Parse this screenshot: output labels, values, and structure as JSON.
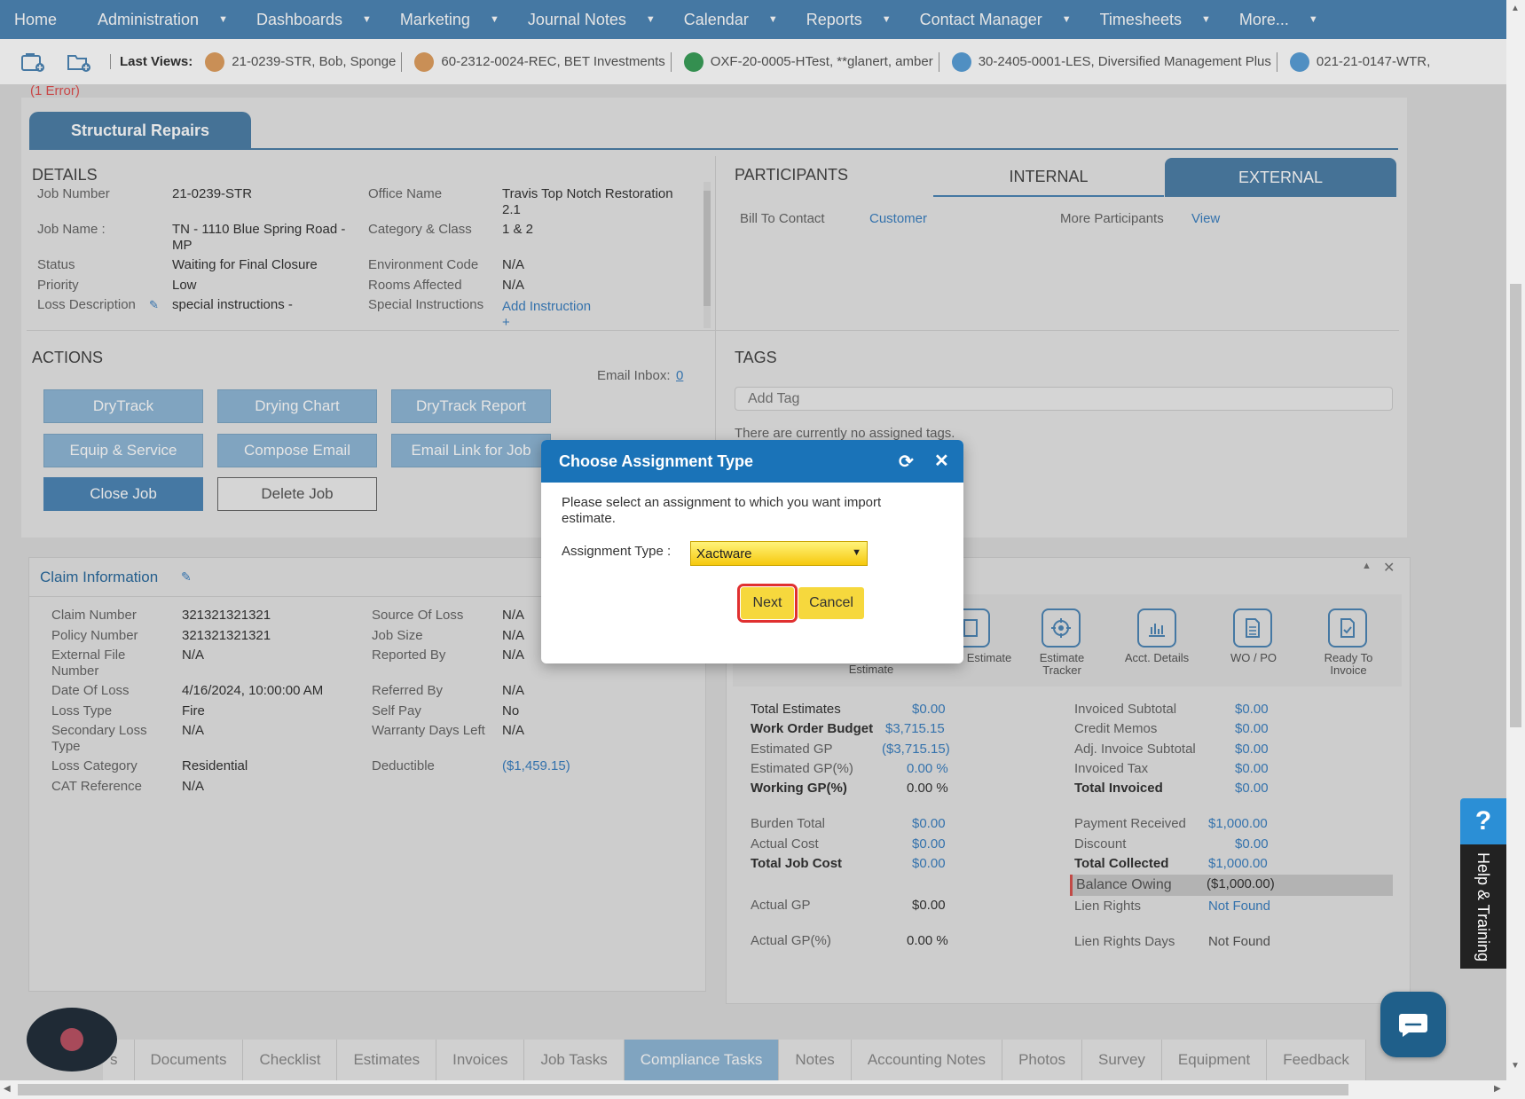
{
  "nav": {
    "home": "Home",
    "items": [
      "Administration",
      "Dashboards",
      "Marketing",
      "Journal Notes",
      "Calendar",
      "Reports",
      "Contact Manager",
      "Timesheets",
      "More..."
    ]
  },
  "last_views": {
    "label": "Last Views:",
    "items": [
      {
        "text": "21-0239-STR, Bob, Sponge",
        "color": "#e0a060"
      },
      {
        "text": "60-2312-0024-REC, BET Investments",
        "color": "#e0a060"
      },
      {
        "text": "OXF-20-0005-HTest, **glanert, amber",
        "color": "#3aa05a"
      },
      {
        "text": "30-2405-0001-LES, Diversified Management Plus",
        "color": "#5aa0d8"
      },
      {
        "text": "021-21-0147-WTR,",
        "color": "#5aa0d8"
      }
    ]
  },
  "error_text": "(1 Error)",
  "job_tab": "Structural Repairs",
  "details": {
    "title": "DETAILS",
    "left": [
      {
        "label": "Job Number",
        "value": "21-0239-STR"
      },
      {
        "label": "Job Name :",
        "value": "TN - 1110 Blue Spring Road - MP"
      },
      {
        "label": "Status",
        "value": "Waiting for Final Closure"
      },
      {
        "label": "Priority",
        "value": "Low"
      },
      {
        "label": "Loss Description",
        "value": "special instructions -"
      }
    ],
    "right": [
      {
        "label": "Office Name",
        "value": "Travis Top Notch Restoration 2.1"
      },
      {
        "label": "Category & Class",
        "value": "1 & 2"
      },
      {
        "label": "Environment Code",
        "value": "N/A"
      },
      {
        "label": "Rooms Affected",
        "value": "N/A"
      },
      {
        "label": "Special Instructions",
        "value": "Add Instruction +"
      }
    ]
  },
  "participants": {
    "title": "PARTICIPANTS",
    "tab_internal": "INTERNAL",
    "tab_external": "EXTERNAL",
    "bill_to_label": "Bill To Contact",
    "bill_to_value": "Customer",
    "more_label": "More Participants",
    "more_value": "View"
  },
  "actions": {
    "title": "ACTIONS",
    "email_inbox_label": "Email Inbox:",
    "email_inbox_count": "0",
    "buttons": {
      "drytrack": "DryTrack",
      "drying_chart": "Drying Chart",
      "drytrack_report": "DryTrack Report",
      "equip_service": "Equip & Service",
      "compose_email": "Compose Email",
      "email_link": "Email Link for Job",
      "close_job": "Close Job",
      "delete_job": "Delete Job"
    }
  },
  "tags": {
    "title": "TAGS",
    "placeholder": "Add Tag",
    "empty": "There are currently no assigned tags."
  },
  "claim": {
    "title": "Claim Information",
    "left": [
      {
        "label": "Claim Number",
        "value": "321321321321"
      },
      {
        "label": "Policy Number",
        "value": "321321321321"
      },
      {
        "label": "External File Number",
        "value": "N/A"
      },
      {
        "label": "Date Of Loss",
        "value": "4/16/2024, 10:00:00 AM"
      },
      {
        "label": "Loss Type",
        "value": "Fire"
      },
      {
        "label": "Secondary Loss Type",
        "value": "N/A"
      },
      {
        "label": "Loss Category",
        "value": "Residential"
      },
      {
        "label": "CAT Reference",
        "value": "N/A"
      }
    ],
    "right": [
      {
        "label": "Source Of Loss",
        "value": "N/A"
      },
      {
        "label": "Job Size",
        "value": "N/A"
      },
      {
        "label": "Reported By",
        "value": "N/A"
      },
      {
        "label": "Referred By",
        "value": "N/A"
      },
      {
        "label": "Self Pay",
        "value": "No"
      },
      {
        "label": "Warranty Days Left",
        "value": "N/A"
      },
      {
        "label": "Deductible",
        "value": "($1,459.15)"
      }
    ]
  },
  "financial": {
    "icons": [
      {
        "label": "Estimate"
      },
      {
        "label": "Estimate Tracker"
      },
      {
        "label": "Acct. Details"
      },
      {
        "label": "WO / PO"
      },
      {
        "label": "Ready To Invoice"
      }
    ],
    "partial_label": "Estimate",
    "left": [
      {
        "label": "Total Estimates",
        "value": "$0.00"
      },
      {
        "label": "Work Order Budget",
        "value": "$3,715.15"
      },
      {
        "label": "Estimated GP",
        "value": "($3,715.15)"
      },
      {
        "label": "Estimated GP(%)",
        "value": "0.00 %"
      },
      {
        "label": "Working GP(%)",
        "value": "0.00 %"
      },
      {
        "label": "Burden Total",
        "value": "$0.00"
      },
      {
        "label": "Actual Cost",
        "value": "$0.00"
      },
      {
        "label": "Total Job Cost",
        "value": "$0.00"
      },
      {
        "label": "Actual GP",
        "value": "$0.00"
      },
      {
        "label": "Actual GP(%)",
        "value": "0.00 %"
      }
    ],
    "right": [
      {
        "label": "Invoiced Subtotal",
        "value": "$0.00"
      },
      {
        "label": "Credit Memos",
        "value": "$0.00"
      },
      {
        "label": "Adj. Invoice Subtotal",
        "value": "$0.00"
      },
      {
        "label": "Invoiced Tax",
        "value": "$0.00"
      },
      {
        "label": "Total Invoiced",
        "value": "$0.00"
      },
      {
        "label": "Payment Received",
        "value": "$1,000.00"
      },
      {
        "label": "Discount",
        "value": "$0.00"
      },
      {
        "label": "Total Collected",
        "value": "$1,000.00"
      },
      {
        "label": "Balance Owing",
        "value": "($1,000.00)"
      },
      {
        "label": "Lien Rights",
        "value": "Not Found"
      },
      {
        "label": "Lien Rights Days",
        "value": "Not Found"
      }
    ]
  },
  "bottom_tabs": [
    "s",
    "Documents",
    "Checklist",
    "Estimates",
    "Invoices",
    "Job Tasks",
    "Compliance Tasks",
    "Notes",
    "Accounting Notes",
    "Photos",
    "Survey",
    "Equipment",
    "Feedback"
  ],
  "modal": {
    "title": "Choose Assignment Type",
    "message": "Please select an assignment to which you want import estimate.",
    "field_label": "Assignment Type :",
    "selected": "Xactware",
    "next": "Next",
    "cancel": "Cancel"
  },
  "help": {
    "q": "?",
    "label": "Help & Training"
  }
}
